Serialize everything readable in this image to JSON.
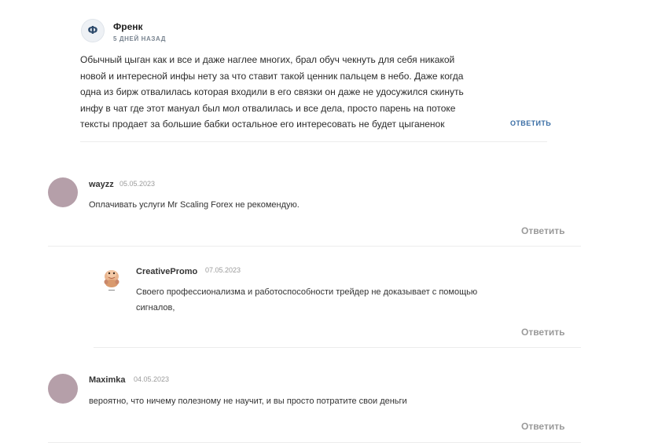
{
  "comments": [
    {
      "avatar_letter": "Ф",
      "author": "Френк",
      "date": "5 ДНЕЙ НАЗАД",
      "text_lines": [
        "Обычный цыган как и все и даже наглее многих, брал обуч чекнуть для себя никакой",
        "новой и интересной инфы нету за что ставит такой ценник пальцем в небо. Даже когда",
        "одна из бирж отвалилась которая входили в его связки он даже не удосужился скинуть",
        "инфу в чат где этот мануал был мол отвалилась и все дела, просто парень на потоке",
        "тексты продает за большие бабки остальное его интересовать не будет цыганенок"
      ],
      "reply_label": "ОТВЕТИТЬ"
    },
    {
      "author": "wayzz",
      "date": "05.05.2023",
      "text_lines": [
        "Оплачивать услуги Mr Scaling Forex не рекомендую."
      ],
      "reply_label": "Ответить",
      "avatar_color": "#b59fa9"
    },
    {
      "author": "CreativePromo",
      "date": "07.05.2023",
      "text_lines": [
        "Своего профессионализма и работоспособности трейдер не доказывает с помощью",
        "сигналов,"
      ],
      "reply_label": "Ответить",
      "avatar_icon": "cartoon-character-icon"
    },
    {
      "author": "Maximka",
      "date": "04.05.2023",
      "text_lines": [
        "вероятно, что ничему полезному не научит, и вы просто потратите свои деньги"
      ],
      "reply_label": "Ответить",
      "avatar_color": "#b59fa9"
    }
  ]
}
